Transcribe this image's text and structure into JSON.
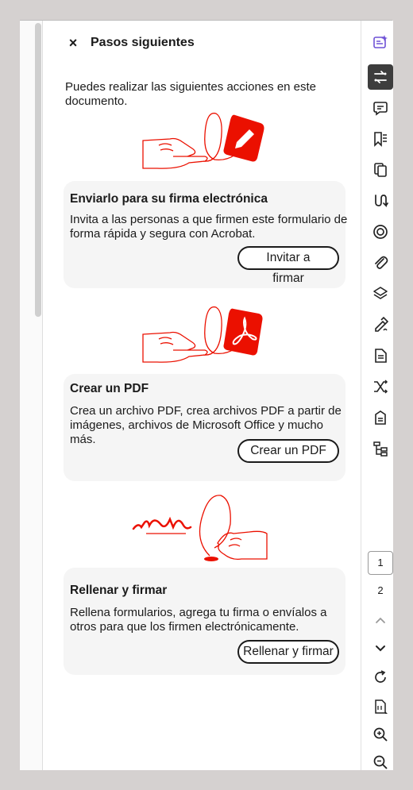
{
  "panel": {
    "title": "Pasos siguientes",
    "intro": "Puedes realizar las siguientes acciones en este documento."
  },
  "cards": [
    {
      "title": "Enviarlo para su firma electrónica",
      "description": "Invita a las personas a que firmen este formulario de forma rápida y segura con Acrobat.",
      "button": "Invitar a firmar"
    },
    {
      "title": "Crear un PDF",
      "description": "Crea un archivo PDF, crea archivos PDF a partir de imágenes, archivos de Microsoft Office y mucho más.",
      "button": "Crear un PDF"
    },
    {
      "title": "Rellenar y firmar",
      "description": "Rellena formularios, agrega tu firma o envíalos a otros para que los firmen electrónicamente.",
      "button": "Rellenar y firmar"
    }
  ],
  "pager": {
    "current": "1",
    "next": "2"
  },
  "toolbar_icons": [
    "ai-assistant-icon",
    "next-steps-icon",
    "comment-icon",
    "bookmark-icon",
    "pages-icon",
    "convert-icon",
    "target-icon",
    "attachment-icon",
    "layers-icon",
    "fill-sign-icon",
    "document-icon",
    "compare-icon",
    "form-icon",
    "structure-icon"
  ],
  "colors": {
    "accent": "#eb1000",
    "ai_purple": "#6f52d6",
    "active_bg": "#3d3d3d"
  }
}
